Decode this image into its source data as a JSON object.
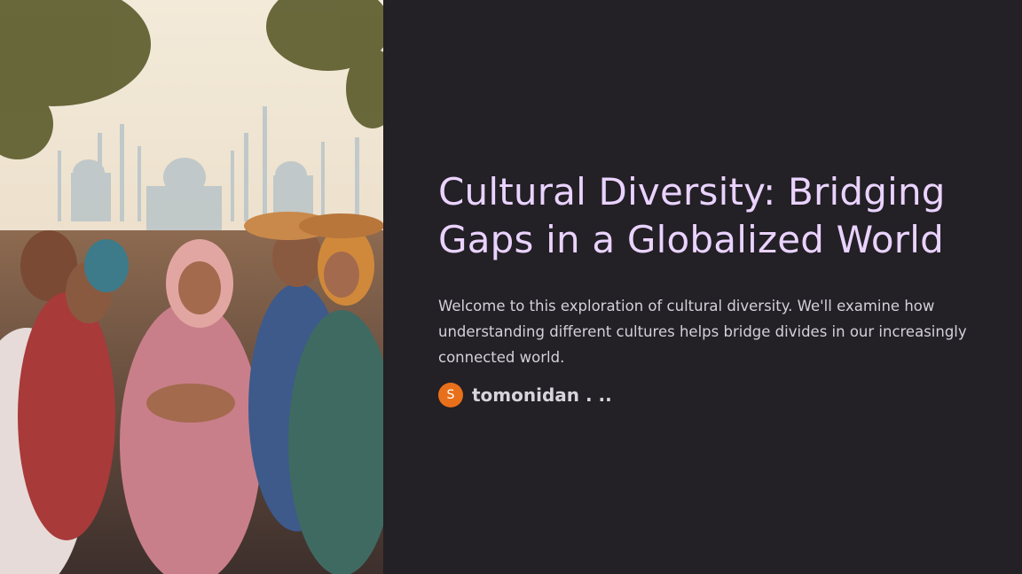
{
  "slide": {
    "title": "Cultural Diversity: Bridging Gaps in a Globalized World",
    "intro": "Welcome to this exploration of cultural diversity. We'll examine how understanding different cultures helps bridge divides in our increasingly connected world.",
    "author": {
      "avatar_letter": "S",
      "name": "tomonidan . .."
    },
    "image": {
      "icon": "photo-people-joining-hands-mosque-background"
    },
    "colors": {
      "background": "#232026",
      "title": "#ead3ff",
      "body_text": "#d6d0d8",
      "avatar": "#e8701a"
    }
  }
}
